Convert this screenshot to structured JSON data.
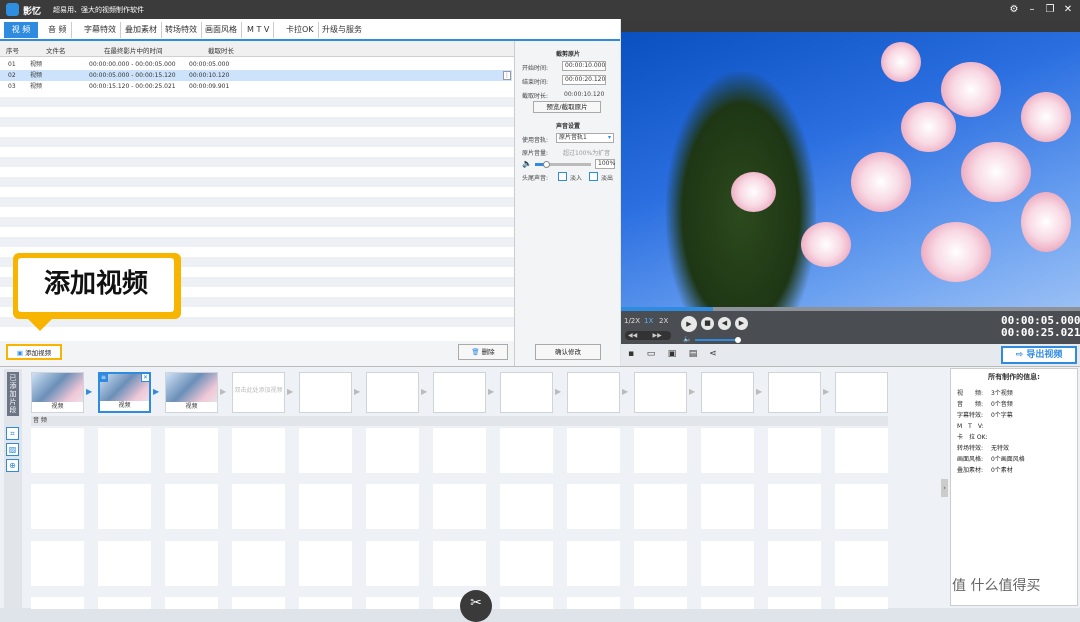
{
  "titlebar": {
    "app_name": "影忆",
    "slogan": "超易用、强大的视频制作软件",
    "buttons": [
      "⚙",
      "–",
      "❐",
      "✕"
    ]
  },
  "tabs": [
    "视 频",
    "音 频",
    "字幕特效",
    "叠加素材",
    "转场特效",
    "画面风格",
    "M T V",
    "卡拉OK",
    "升级与服务"
  ],
  "list": {
    "columns": [
      "序号",
      "文件名",
      "在最终影片中的时间",
      "截取时长"
    ],
    "rows": [
      {
        "no": "01",
        "name": "视频",
        "time": "00:00:00.000 - 00:00:05.000",
        "dur": "00:00:05.000"
      },
      {
        "no": "02",
        "name": "视频",
        "time": "00:00:05.000 - 00:00:15.120",
        "dur": "00:00:10.120"
      },
      {
        "no": "03",
        "name": "视频",
        "time": "00:00:15.120 - 00:00:25.021",
        "dur": "00:00:09.901"
      }
    ],
    "add_button": "添加视频",
    "delete_button": "删除"
  },
  "side": {
    "crop_title": "截剪原片",
    "start_label": "开始时间:",
    "start_value": "00:00:10.000",
    "end_label": "结束时间:",
    "end_value": "00:00:20.120",
    "dur_label": "截取时长:",
    "dur_value": "00:00:10.120",
    "preview_btn": "预览/截取原片",
    "sound_title": "声音设置",
    "track_label": "使用音轨:",
    "track_value": "原片音轨1",
    "volume_label": "原片音量:",
    "volume_hint": "超过100%为扩音",
    "volume_value": "100%",
    "fade_label": "头尾声音:",
    "fade_in": "淡入",
    "fade_out": "淡出",
    "confirm_btn": "确认修改"
  },
  "player": {
    "speeds": [
      "1/2X",
      "1X",
      "2X"
    ],
    "current_time": "00:00:05.000",
    "total_time": "00:00:25.021",
    "export_btn": "导出视频",
    "progress": 0.2
  },
  "timeline": {
    "side_label": "已添加片段",
    "clips": [
      "视频",
      "视频",
      "视频"
    ],
    "empty_hint": "双击此处添加视频",
    "audio_label": "音 频"
  },
  "info": {
    "title": "所有制作的信息:",
    "rows": [
      {
        "k": "视　　频:",
        "v": "3个视频"
      },
      {
        "k": "音　　频:",
        "v": "0个音频"
      },
      {
        "k": "字幕特效:",
        "v": "0个字幕"
      },
      {
        "k": "M　T　V:",
        "v": ""
      },
      {
        "k": "卡　拉 OK:",
        "v": ""
      },
      {
        "k": "转场特效:",
        "v": "无特效"
      },
      {
        "k": "画面风格:",
        "v": "0个画面风格"
      },
      {
        "k": "叠加素材:",
        "v": "0个素材"
      }
    ]
  },
  "callout": "添加视频",
  "watermark": "值 什么值得买",
  "colors": {
    "accent": "#2f8be0",
    "callout": "#f7b500"
  }
}
